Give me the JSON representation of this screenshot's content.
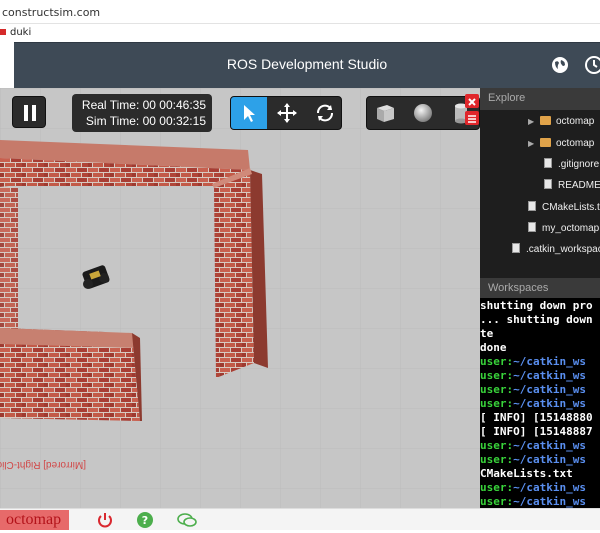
{
  "browser": {
    "url": "constructsim.com",
    "bookmark_label": "duki"
  },
  "header": {
    "title": "ROS Development Studio",
    "globe_icon": "globe-icon",
    "clock_icon": "clock-icon"
  },
  "sim": {
    "real_time_label": "Real Time: 00 00:46:35",
    "sim_time_label": "Sim Time: 00 00:32:15",
    "pause_icon": "pause-icon",
    "tools": [
      "select-arrow-icon",
      "translate-move-icon",
      "rotate-icon"
    ],
    "shapes": [
      "box-shape-icon",
      "sphere-shape-icon",
      "cylinder-shape-icon"
    ],
    "mirrored_text": "[Mirrored] Right-Click to reset"
  },
  "explorer": {
    "header": "Explore",
    "items": [
      {
        "label": "octomap",
        "type": "folder",
        "expandable": true
      },
      {
        "label": "octomap",
        "type": "folder",
        "expandable": true
      },
      {
        "label": ".gitignore",
        "type": "file"
      },
      {
        "label": "README",
        "type": "file"
      },
      {
        "label": "CMakeLists.txt",
        "type": "file"
      },
      {
        "label": "my_octomap",
        "type": "file"
      },
      {
        "label": ".catkin_workspace",
        "type": "file"
      }
    ]
  },
  "workspaces": {
    "header": "Workspaces"
  },
  "terminal": {
    "lines": [
      {
        "plain": "shutting down pro"
      },
      {
        "plain": "... shutting down"
      },
      {
        "plain": "te"
      },
      {
        "plain": "done"
      },
      {
        "user": "user:",
        "path": "~/catkin_ws"
      },
      {
        "user": "user:",
        "path": "~/catkin_ws"
      },
      {
        "user": "user:",
        "path": "~/catkin_ws"
      },
      {
        "user": "user:",
        "path": "~/catkin_ws"
      },
      {
        "plain": "[ INFO] [15148880"
      },
      {
        "plain": "[ INFO] [15148887"
      },
      {
        "user": "user:",
        "path": "~/catkin_ws"
      },
      {
        "user": "user:",
        "path": "~/catkin_ws"
      },
      {
        "plain": "CMakeLists.txt"
      },
      {
        "user": "user:",
        "path": "~/catkin_ws"
      },
      {
        "user": "user:",
        "path": "~/catkin_ws"
      }
    ]
  },
  "bottombar": {
    "project_name": "octomap",
    "power_icon": "power-icon",
    "help_icon": "help-icon",
    "chat_icon": "chat-icon"
  },
  "colors": {
    "header_bg": "#3e4a56",
    "tool_active": "#2da1e8",
    "terminal_user": "#38d23a",
    "terminal_path": "#5a8ff0",
    "close_red": "#e0262b"
  }
}
